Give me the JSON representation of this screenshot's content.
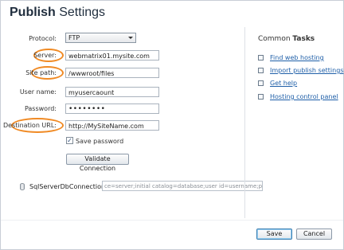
{
  "window": {
    "title_bold": "Publish",
    "title_rest": " Settings"
  },
  "form": {
    "protocol": {
      "label": "Protocol:",
      "value": "FTP"
    },
    "server": {
      "label": "Server:",
      "value": "webmatrix01.mysite.com"
    },
    "site_path": {
      "label": "Site path:",
      "value": "/wwwroot/files"
    },
    "user_name": {
      "label": "User name:",
      "value": "myusercaount"
    },
    "password": {
      "label": "Password:",
      "value": "••••••••"
    },
    "destination_url": {
      "label": "Destination URL:",
      "value": "http://MySiteName.com"
    },
    "save_password": {
      "label": "Save password",
      "checked": true,
      "mark": "✓"
    },
    "validate_button": "Validate Connection"
  },
  "connection": {
    "label": "SqlServerDbConnection",
    "value": "ce=server;initial catalog=database;user id=username;password="
  },
  "tasks": {
    "title_prefix": "Common ",
    "title_bold": "Tasks",
    "items": [
      {
        "label": "Find web hosting",
        "icon": "link-icon"
      },
      {
        "label": "Import publish settings",
        "icon": "import-icon"
      },
      {
        "label": "Get help",
        "icon": "help-icon"
      },
      {
        "label": "Hosting control panel",
        "icon": "panel-icon"
      }
    ]
  },
  "footer": {
    "save": "Save",
    "cancel": "Cancel"
  },
  "colors": {
    "highlight": "#f08a24",
    "link": "#1f5fa8"
  }
}
